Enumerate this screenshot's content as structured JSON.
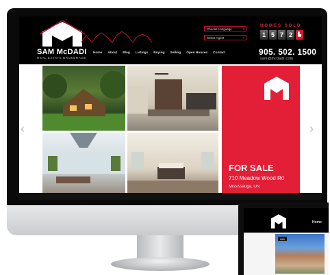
{
  "site": {
    "brand_name": "SAM McDADI",
    "brand_sub": "REAL ESTATE BROKERAGE",
    "nav": [
      "Home",
      "About",
      "Blog",
      "Listings",
      "Buying",
      "Selling",
      "Open Houses",
      "Contact"
    ],
    "choose_language": "Choose Language",
    "select_agent": "Select Agent",
    "homes_sold_title": "HOMES SOLD",
    "homes_sold_digits": [
      "1",
      "5",
      "7",
      "2"
    ],
    "phone": "905. 502. 1500",
    "email": "sam@mcdadi.com"
  },
  "hero": {
    "for_sale": "FOR SALE",
    "address": "710 Meadow Wood Rd",
    "city": "Mississauga, ON"
  },
  "tablet": {
    "nav_item": "Home"
  },
  "colors": {
    "accent_red": "#e21f36",
    "header_bg": "#000000"
  }
}
